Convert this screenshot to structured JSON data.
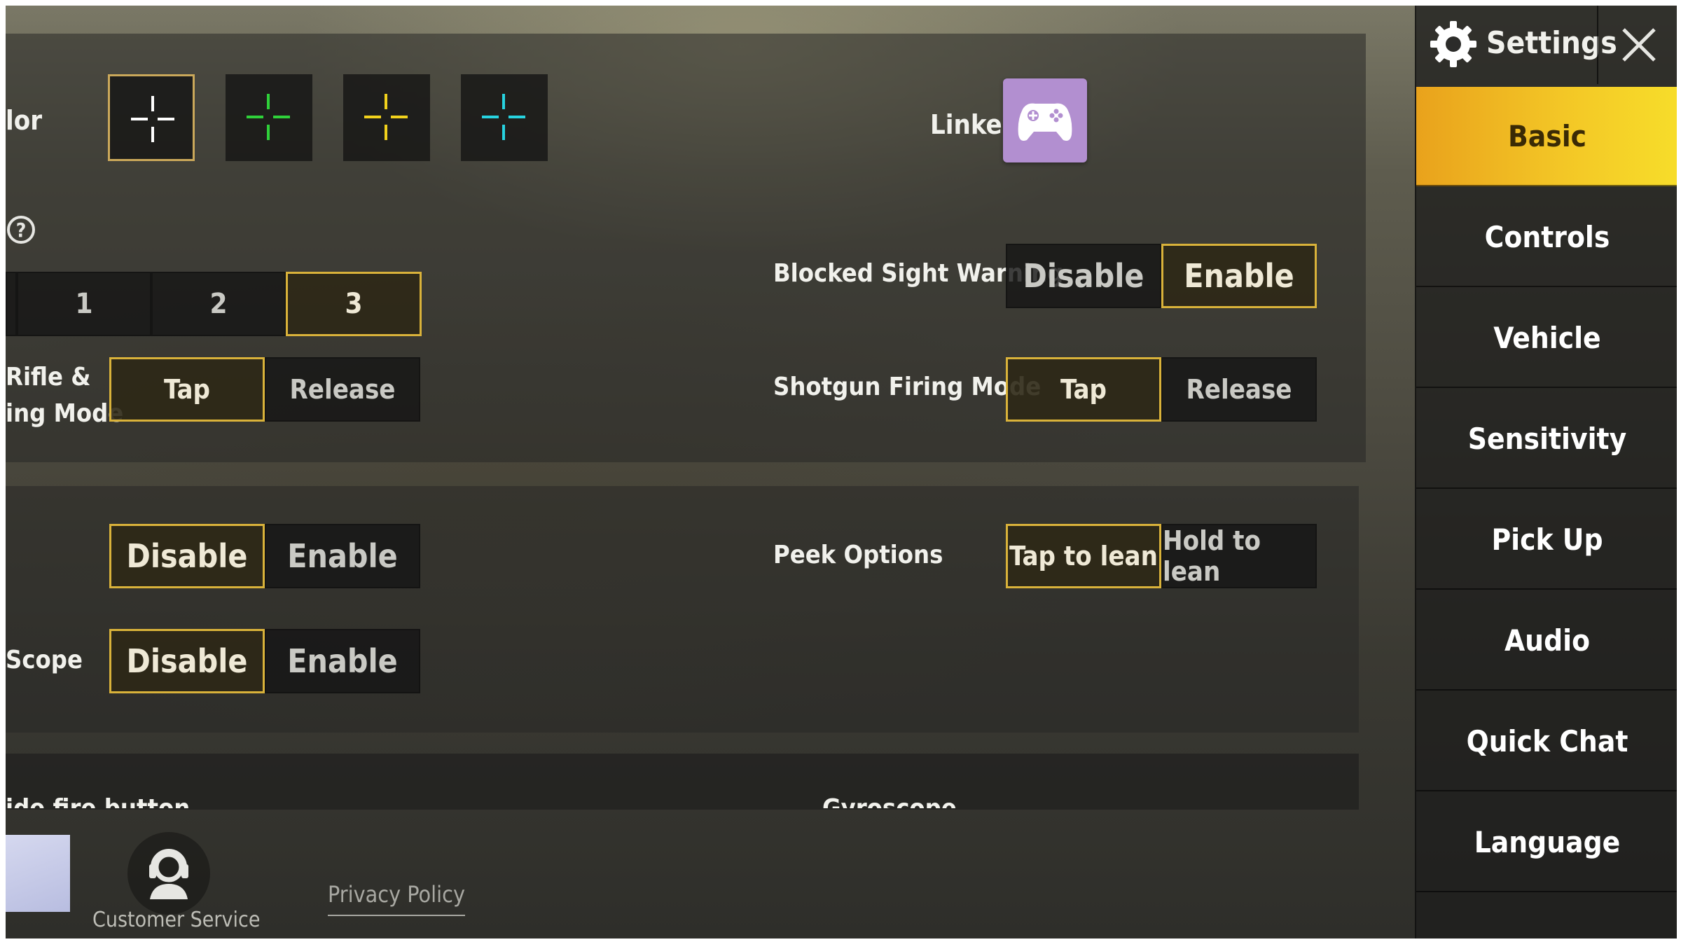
{
  "sidebar": {
    "title": "Settings",
    "items": [
      {
        "label": "Basic",
        "active": true
      },
      {
        "label": "Controls",
        "active": false
      },
      {
        "label": "Vehicle",
        "active": false
      },
      {
        "label": "Sensitivity",
        "active": false
      },
      {
        "label": "Pick Up",
        "active": false
      },
      {
        "label": "Audio",
        "active": false
      },
      {
        "label": "Quick Chat",
        "active": false
      },
      {
        "label": "Language",
        "active": false
      }
    ]
  },
  "crosshair": {
    "label_partial": "lor",
    "colors": [
      "#ffffff",
      "#2fd13a",
      "#f2d21c",
      "#27d3e0"
    ],
    "selected_index": 0
  },
  "controller": {
    "label": "Linked",
    "color": "#b28fd0"
  },
  "help": {
    "symbol": "?"
  },
  "number_selector": {
    "options": [
      "1",
      "2",
      "3"
    ],
    "selected": "3"
  },
  "blocked_sight": {
    "label": "Blocked Sight Warning",
    "options": [
      "Disable",
      "Enable"
    ],
    "selected": "Enable"
  },
  "rifle_firing": {
    "label_line1": "Rifle &",
    "label_line2": "ing Mode",
    "options": [
      "Tap",
      "Release"
    ],
    "selected": "Tap"
  },
  "shotgun_firing": {
    "label": "Shotgun Firing Mode",
    "options": [
      "Tap",
      "Release"
    ],
    "selected": "Tap"
  },
  "unnamed_toggle": {
    "options": [
      "Disable",
      "Enable"
    ],
    "selected": "Disable"
  },
  "peek_options": {
    "label": "Peek Options",
    "options": [
      "Tap to lean",
      "Hold to lean"
    ],
    "selected": "Tap to lean"
  },
  "scope": {
    "label": "Scope",
    "options": [
      "Disable",
      "Enable"
    ],
    "selected": "Disable"
  },
  "cutoff_row": {
    "left_label": "ide fire button",
    "right_label": "Gyroscope"
  },
  "footer": {
    "customer_service": "Customer Service",
    "privacy_policy": "Privacy Policy"
  },
  "colors": {
    "accent_gold": "#d9b23a",
    "active_tab": "#f3c626"
  }
}
